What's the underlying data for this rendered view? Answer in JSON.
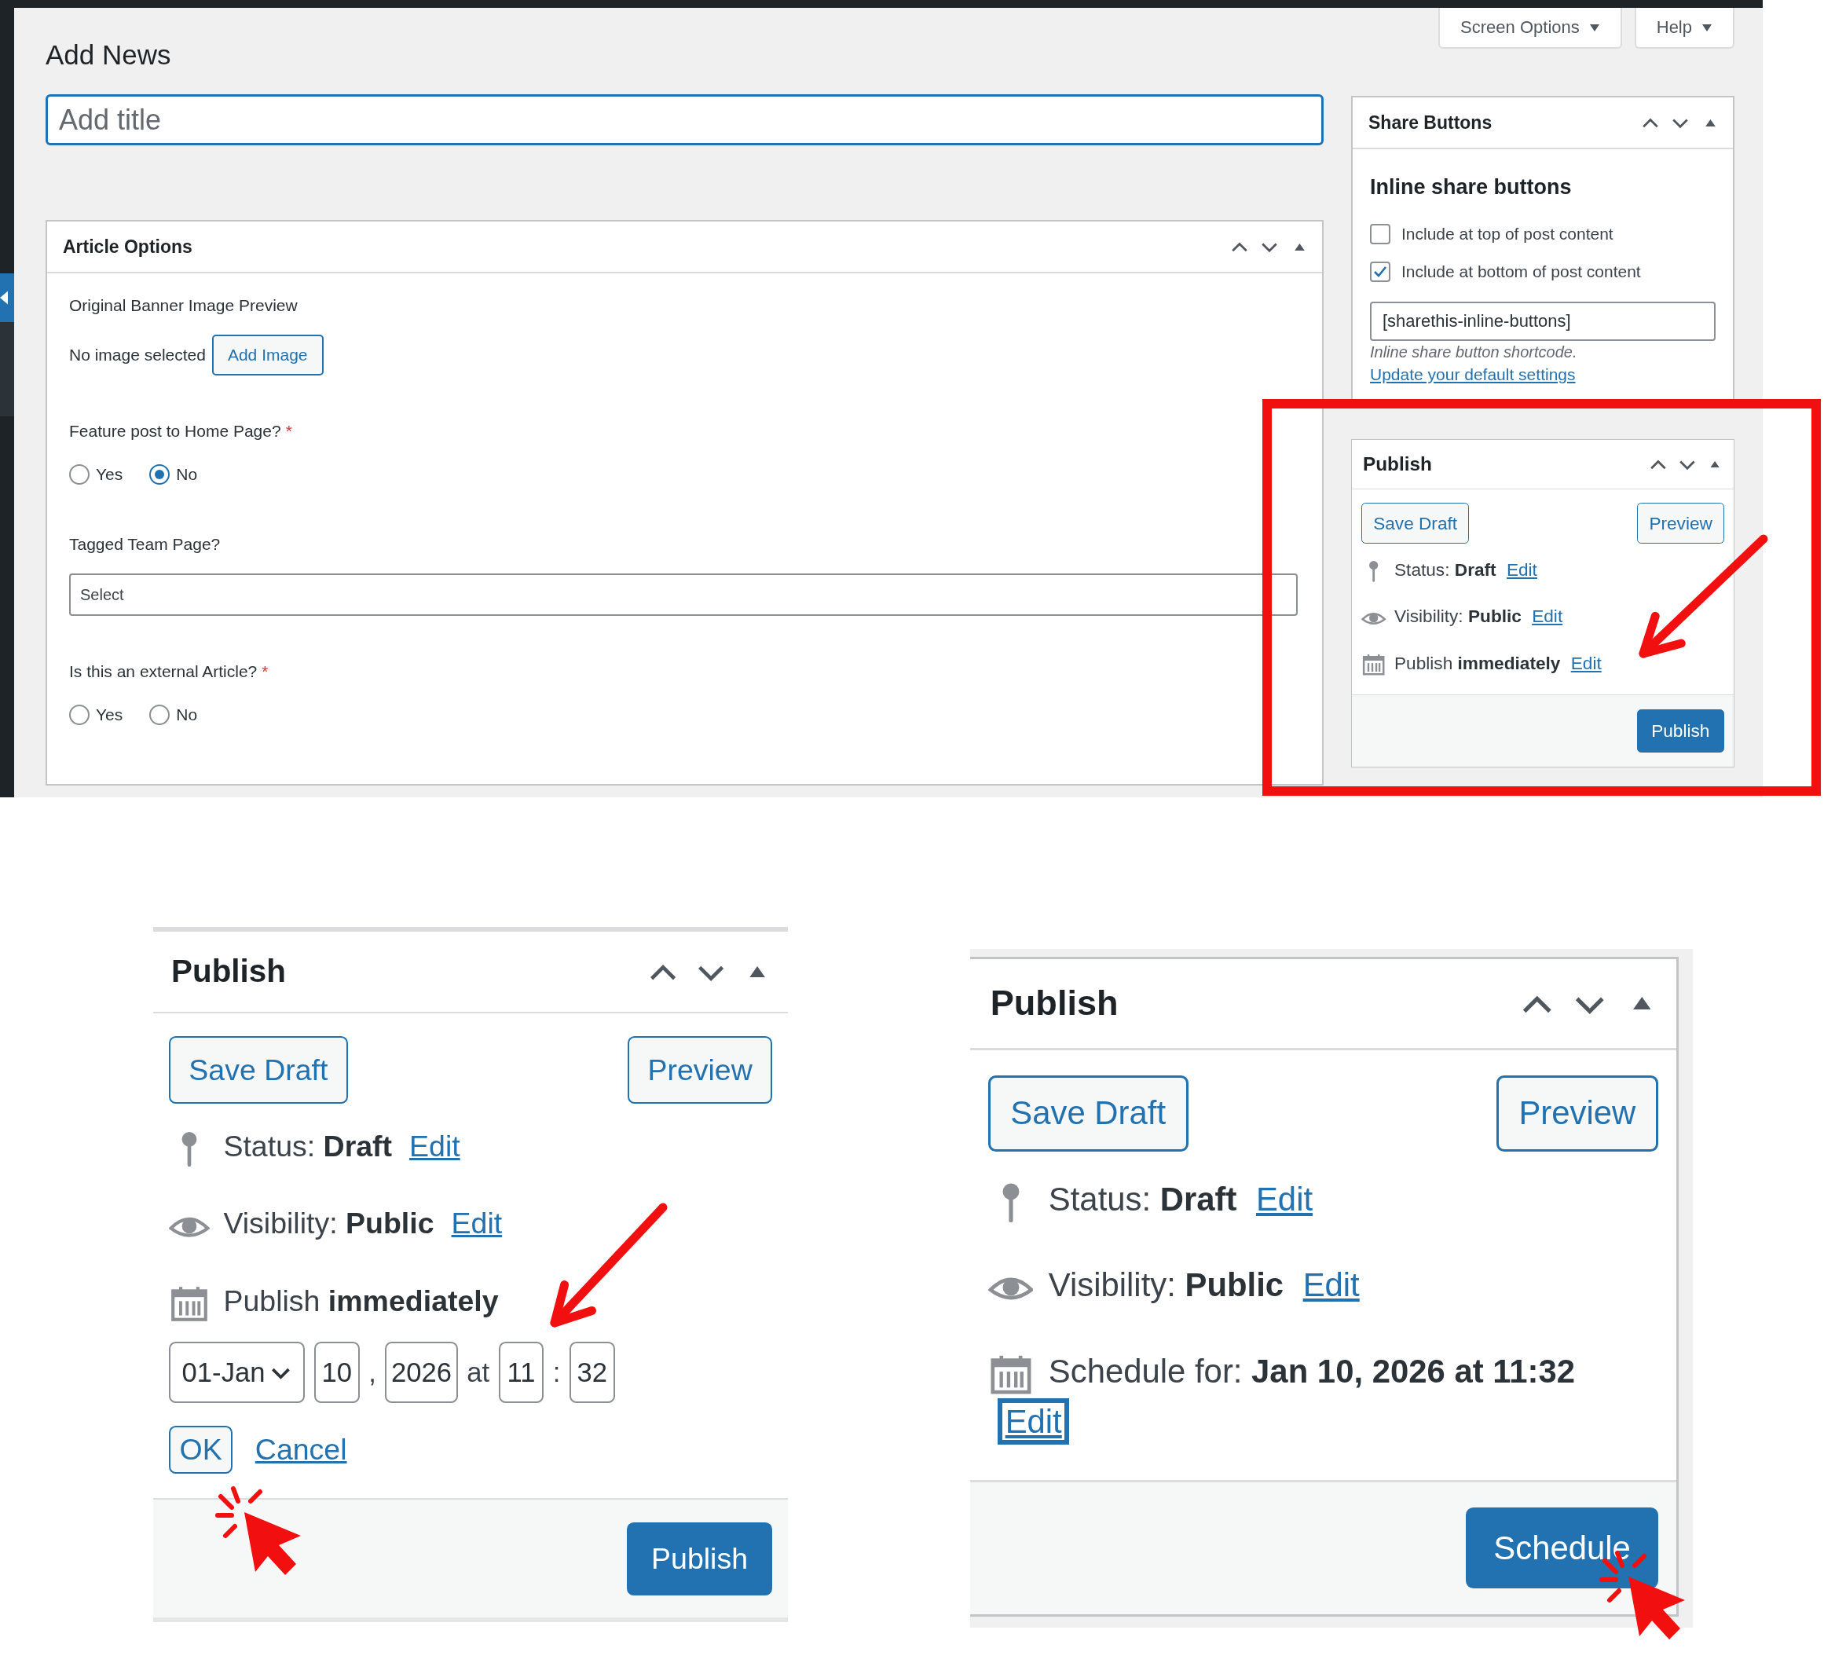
{
  "top_screenshot": {
    "header_buttons": [
      {
        "label": "Screen Options"
      },
      {
        "label": "Help"
      }
    ],
    "page_title": "Add News",
    "title_field": {
      "placeholder": "Add title"
    },
    "article_options": {
      "title": "Article Options",
      "fields": [
        {
          "kind": "image",
          "label": "Original Banner Image Preview",
          "value": "No image selected",
          "button": "Add Image"
        },
        {
          "kind": "radio",
          "label": "Feature post to Home Page?",
          "required_mark": "*",
          "options": [
            {
              "label": "Yes",
              "selected": false
            },
            {
              "label": "No",
              "selected": true
            }
          ]
        },
        {
          "kind": "select",
          "label": "Tagged Team Page?",
          "value": "Select"
        },
        {
          "kind": "radio",
          "label": "Is this an external Article?",
          "required_mark": "*",
          "options": [
            {
              "label": "Yes",
              "selected": false
            },
            {
              "label": "No",
              "selected": false
            }
          ]
        }
      ]
    },
    "share_buttons": {
      "title": "Share Buttons",
      "heading": "Inline share buttons",
      "options": [
        {
          "label": "Include at top of post content",
          "checked": false
        },
        {
          "label": "Include at bottom of post content",
          "checked": true
        }
      ],
      "shortcode": "[sharethis-inline-buttons]",
      "hint": "Inline share button shortcode.",
      "link": "Update your default settings"
    },
    "publish": {
      "title": "Publish",
      "buttons": [
        {
          "label": "Save Draft"
        },
        {
          "label": "Preview"
        }
      ],
      "rows": [
        {
          "kind": "status",
          "text": "Status: **Draft**",
          "link": "Edit",
          "focused": false
        },
        {
          "kind": "visibility",
          "text": "Visibility: **Public**",
          "link": "Edit",
          "focused": false
        },
        {
          "kind": "schedule",
          "text": "Publish **immediately**",
          "link": "Edit",
          "focused": false
        }
      ],
      "primary_button": "Publish"
    }
  },
  "zoomed_publish": [
    {
      "title": "Publish",
      "buttons": [
        {
          "label": "Save Draft"
        },
        {
          "label": "Preview"
        }
      ],
      "rows": [
        {
          "kind": "status",
          "text": "Status: **Draft**",
          "link": "Edit",
          "focused": false
        },
        {
          "kind": "visibility",
          "text": "Visibility: **Public**",
          "link": "Edit",
          "focused": false
        },
        {
          "kind": "schedule",
          "text": "Publish **immediately**"
        }
      ],
      "date_editor": {
        "month": "01-Jan",
        "day": "10",
        "separator": ",",
        "year": "2026",
        "at": "at",
        "hour": "11",
        "time_separator": ":",
        "minute": "32",
        "ok": "OK",
        "cancel": "Cancel"
      },
      "primary_button": "Publish"
    },
    {
      "title": "Publish",
      "buttons": [
        {
          "label": "Save Draft"
        },
        {
          "label": "Preview"
        }
      ],
      "rows": [
        {
          "kind": "status",
          "text": "Status: **Draft**",
          "link": "Edit",
          "focused": false
        },
        {
          "kind": "visibility",
          "text": "Visibility: **Public**",
          "link": "Edit",
          "focused": false
        },
        {
          "kind": "schedule",
          "text": "Schedule for: **Jan 10, 2026 at 11:32**",
          "link": "Edit",
          "focused": true
        }
      ],
      "primary_button": "Schedule"
    }
  ]
}
